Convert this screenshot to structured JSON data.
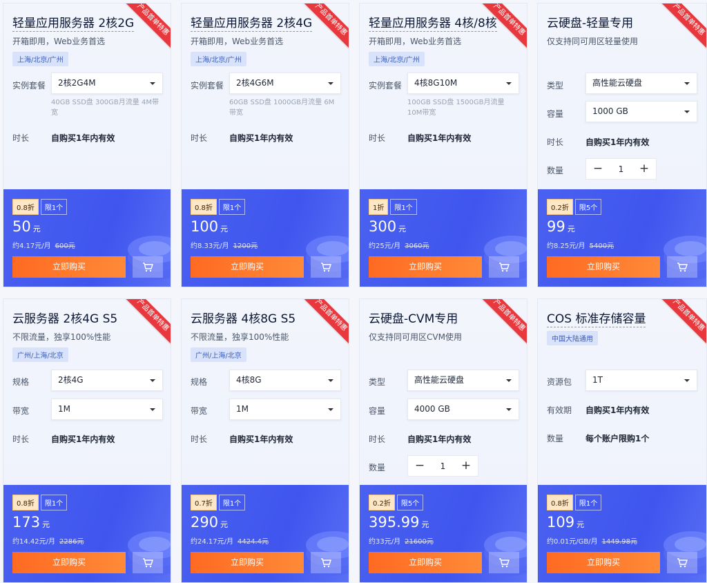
{
  "ribbon": "产品首单特惠",
  "row1": [
    {
      "title": "轻量应用服务器 2核2G",
      "subtitle": "开箱即用，Web业务首选",
      "region": "上海/北京/广州",
      "lbl_plan": "实例套餐",
      "plan": "2核2G4M",
      "note": "40GB SSD盘 300GB月流量 4M带宽",
      "lbl_dur": "时长",
      "duration": "自购买1年内有效",
      "discount": "0.8折",
      "limit": "限1个",
      "price": "50",
      "unit": "元",
      "per": "约4.17元/月",
      "orig": "600元",
      "buy": "立即购买"
    },
    {
      "title": "轻量应用服务器 2核4G",
      "subtitle": "开箱即用，Web业务首选",
      "region": "上海/北京/广州",
      "lbl_plan": "实例套餐",
      "plan": "2核4G6M",
      "note": "60GB SSD盘 1000GB月流量 6M带宽",
      "lbl_dur": "时长",
      "duration": "自购买1年内有效",
      "discount": "0.8折",
      "limit": "限1个",
      "price": "100",
      "unit": "元",
      "per": "约8.33元/月",
      "orig": "1200元",
      "buy": "立即购买"
    },
    {
      "title": "轻量应用服务器 4核/8核",
      "subtitle": "开箱即用，Web业务首选",
      "region": "上海/北京/广州",
      "lbl_plan": "实例套餐",
      "plan": "4核8G10M",
      "note": "100GB SSD盘 1500GB月流量 10M带宽",
      "lbl_dur": "时长",
      "duration": "自购买1年内有效",
      "discount": "1折",
      "limit": "限1个",
      "price": "300",
      "unit": "元",
      "per": "约25元/月",
      "orig": "3060元",
      "buy": "立即购买"
    },
    {
      "title": "云硬盘-轻量专用",
      "subtitle": "仅支持同可用区轻量使用",
      "lbl_type": "类型",
      "type": "高性能云硬盘",
      "lbl_cap": "容量",
      "capacity": "1000 GB",
      "lbl_dur": "时长",
      "duration": "自购买1年内有效",
      "lbl_qty": "数量",
      "qty": "1",
      "minus": "−",
      "plus": "+",
      "discount": "0.2折",
      "limit": "限5个",
      "price": "99",
      "unit": "元",
      "per": "约8.25元/月",
      "orig": "5400元",
      "buy": "立即购买"
    }
  ],
  "row2": [
    {
      "title": "云服务器 2核4G S5",
      "subtitle": "不限流量，独享100%性能",
      "region": "广州/上海/北京",
      "lbl_spec": "规格",
      "spec": "2核4G",
      "lbl_bw": "带宽",
      "bw": "1M",
      "lbl_dur": "时长",
      "duration": "自购买1年内有效",
      "discount": "0.8折",
      "limit": "限1个",
      "price": "173",
      "unit": "元",
      "per": "约14.42元/月",
      "orig": "2286元",
      "buy": "立即购买"
    },
    {
      "title": "云服务器 4核8G S5",
      "subtitle": "不限流量，独享100%性能",
      "region": "广州/上海/北京",
      "lbl_spec": "规格",
      "spec": "4核8G",
      "lbl_bw": "带宽",
      "bw": "1M",
      "lbl_dur": "时长",
      "duration": "自购买1年内有效",
      "discount": "0.7折",
      "limit": "限1个",
      "price": "290",
      "unit": "元",
      "per": "约24.17元/月",
      "orig": "4424.4元",
      "buy": "立即购买"
    },
    {
      "title": "云硬盘-CVM专用",
      "subtitle": "仅支持同可用区CVM使用",
      "lbl_type": "类型",
      "type": "高性能云硬盘",
      "lbl_cap": "容量",
      "capacity": "4000 GB",
      "lbl_dur": "时长",
      "duration": "自购买1年内有效",
      "lbl_qty": "数量",
      "qty": "1",
      "minus": "−",
      "plus": "+",
      "discount": "0.2折",
      "limit": "限5个",
      "price": "395.99",
      "unit": "元",
      "per": "约33元/月",
      "orig": "21600元",
      "buy": "立即购买"
    },
    {
      "title": "COS 标准存储容量",
      "region": "中国大陆通用",
      "lbl_pkg": "资源包",
      "pkg": "1T",
      "lbl_valid": "有效期",
      "valid": "自购买1年内有效",
      "lbl_qty": "数量",
      "qty_text": "每个账户限购1个",
      "discount": "0.8折",
      "limit": "限1个",
      "price": "109",
      "unit": "元",
      "per": "约0.01元/GB/月",
      "orig": "1449.98元",
      "buy": "立即购买"
    }
  ]
}
